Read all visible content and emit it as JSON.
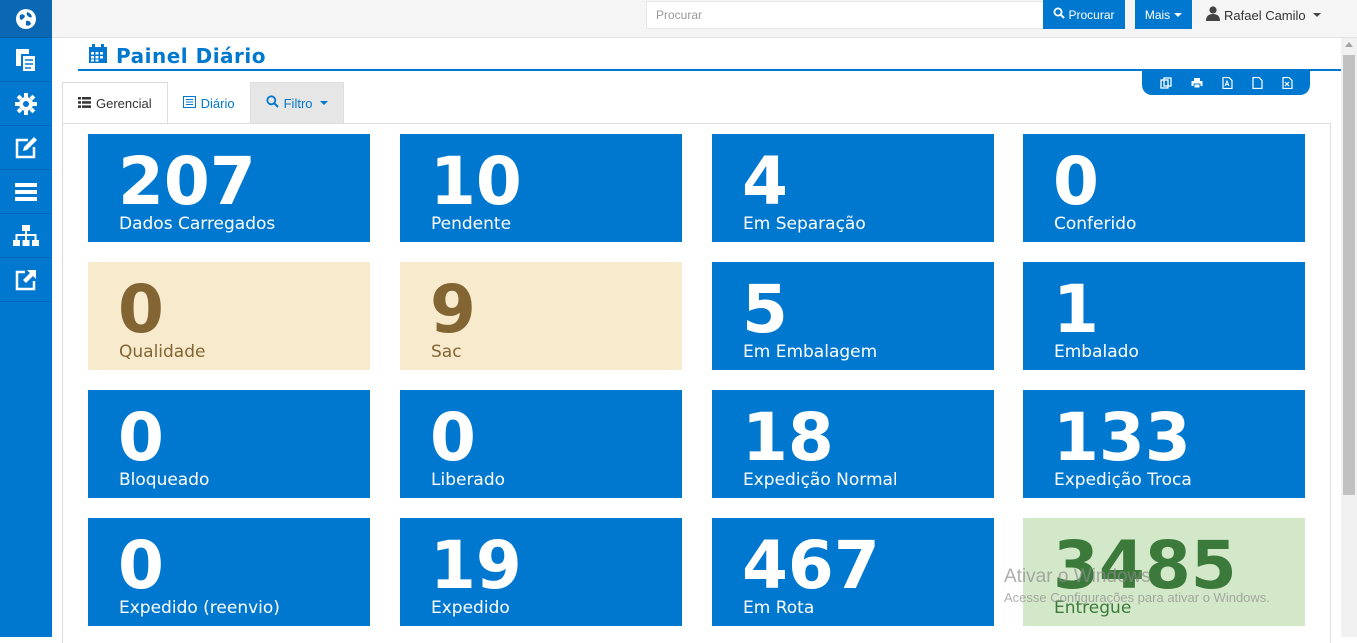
{
  "sidebar": {
    "items": [
      {
        "icon": "globe-icon"
      },
      {
        "icon": "documents-icon"
      },
      {
        "icon": "gear-icon"
      },
      {
        "icon": "edit-icon"
      },
      {
        "icon": "menu-icon"
      },
      {
        "icon": "sitemap-icon"
      },
      {
        "icon": "external-link-icon"
      }
    ]
  },
  "topbar": {
    "search_placeholder": "Procurar",
    "search_button": "Procurar",
    "more_button": "Mais",
    "user_name": "Rafael Camilo"
  },
  "page": {
    "title": "Painel Diário"
  },
  "tabs": [
    {
      "label": "Gerencial",
      "icon": "list-icon",
      "active": true
    },
    {
      "label": "Diário",
      "icon": "list-alt-icon",
      "active": false
    },
    {
      "label": "Filtro",
      "icon": "search-icon",
      "active": false
    }
  ],
  "export_icons": [
    "copy-icon",
    "print-icon",
    "pdf-icon",
    "file-icon",
    "excel-icon"
  ],
  "tiles": [
    {
      "value": "207",
      "label": "Dados Carregados",
      "style": "blue"
    },
    {
      "value": "10",
      "label": "Pendente",
      "style": "blue"
    },
    {
      "value": "4",
      "label": "Em Separação",
      "style": "blue"
    },
    {
      "value": "0",
      "label": "Conferido",
      "style": "blue"
    },
    {
      "value": "0",
      "label": "Qualidade",
      "style": "beige"
    },
    {
      "value": "9",
      "label": "Sac",
      "style": "beige"
    },
    {
      "value": "5",
      "label": "Em Embalagem",
      "style": "blue"
    },
    {
      "value": "1",
      "label": "Embalado",
      "style": "blue"
    },
    {
      "value": "0",
      "label": "Bloqueado",
      "style": "blue"
    },
    {
      "value": "0",
      "label": "Liberado",
      "style": "blue"
    },
    {
      "value": "18",
      "label": "Expedição Normal",
      "style": "blue"
    },
    {
      "value": "133",
      "label": "Expedição Troca",
      "style": "blue"
    },
    {
      "value": "0",
      "label": "Expedido (reenvio)",
      "style": "blue"
    },
    {
      "value": "19",
      "label": "Expedido",
      "style": "blue"
    },
    {
      "value": "467",
      "label": "Em Rota",
      "style": "blue"
    },
    {
      "value": "3485",
      "label": "Entregue",
      "style": "green"
    }
  ],
  "colors": {
    "primary": "#0078d0",
    "beige_bg": "#f8ebcd",
    "beige_text": "#836533",
    "green_bg": "#d3e8c8",
    "green_text": "#3b7a3b"
  },
  "watermark": {
    "line1": "Ativar o Windows",
    "line2": "Acesse Configurações para ativar o Windows."
  }
}
